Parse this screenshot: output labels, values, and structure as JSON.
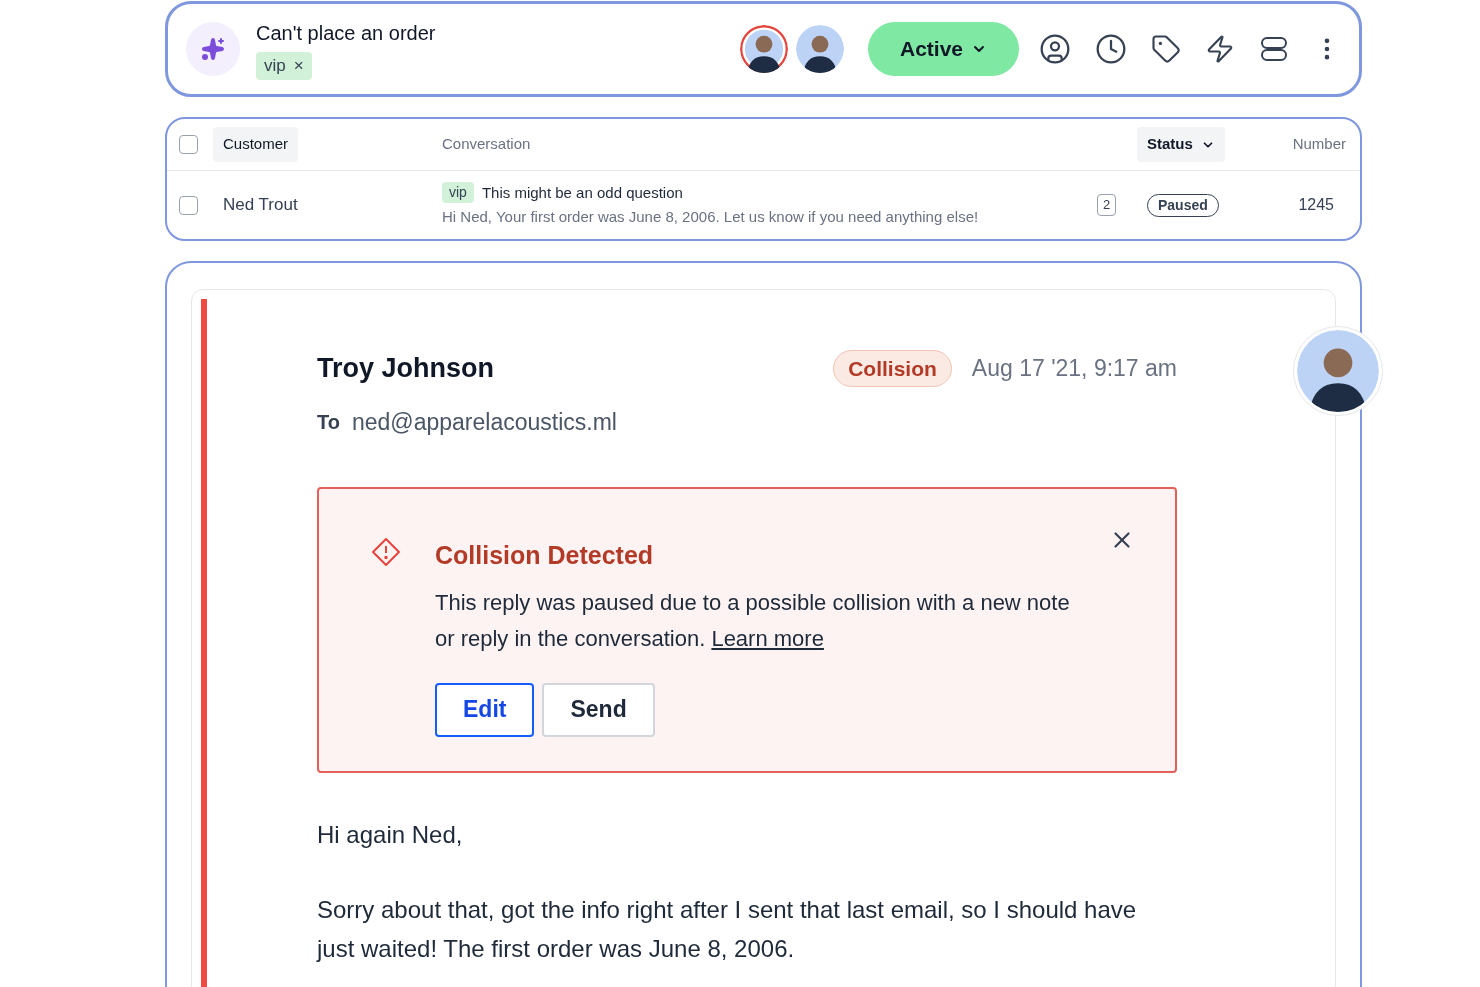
{
  "header": {
    "title": "Can't place an order",
    "tags": [
      {
        "label": "vip",
        "remove": "×"
      }
    ],
    "avatars": [
      {
        "highlighted": true
      },
      {
        "highlighted": false
      }
    ],
    "status_button": "Active"
  },
  "table": {
    "header_checked": false,
    "columns": [
      {
        "label": "Customer",
        "highlighted": true,
        "dropdown": false
      },
      {
        "label": "Conversation",
        "highlighted": false,
        "dropdown": false
      },
      {
        "label": "Status",
        "highlighted": true,
        "dropdown": true
      },
      {
        "label": "Number",
        "highlighted": false,
        "dropdown": false
      }
    ],
    "rows": [
      {
        "checked": false,
        "customer": "Ned Trout",
        "tag": "vip",
        "subject": "This might be an odd question",
        "preview": "Hi Ned, Your first order was June 8, 2006. Let us know if you need anything else!",
        "count": "2",
        "status": "Paused",
        "number": "1245"
      }
    ]
  },
  "message": {
    "sender": "Troy Johnson",
    "badge": "Collision",
    "time": "Aug 17 '21, 9:17 am",
    "to_label": "To",
    "to": "ned@apparelacoustics.ml",
    "alert": {
      "title": "Collision Detected",
      "text": "This reply was paused due to a possible collision with a new note or reply in the conversation.",
      "link": "Learn more",
      "buttons": [
        {
          "label": "Edit",
          "kind": "primary"
        },
        {
          "label": "Send",
          "kind": "secondary"
        }
      ]
    },
    "body": [
      "Hi again Ned,",
      "Sorry about that, got the info right after I sent that last email, so I should have just waited! The first order was June 8, 2006."
    ]
  }
}
